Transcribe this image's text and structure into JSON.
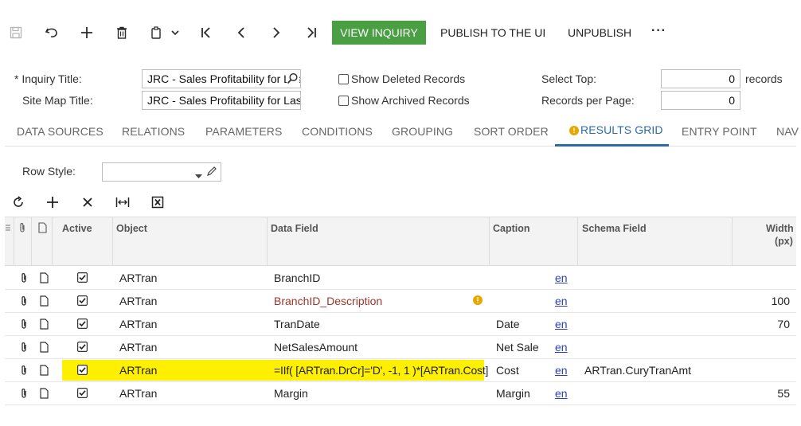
{
  "toolbar": {
    "view_inquiry": "VIEW INQUIRY",
    "publish": "PUBLISH TO THE UI",
    "unpublish": "UNPUBLISH",
    "more": "···"
  },
  "form": {
    "inquiry_title_label": "* Inquiry Title:",
    "inquiry_title_value": "JRC - Sales Profitability for Last",
    "site_map_title_label": "Site Map Title:",
    "site_map_title_value": "JRC - Sales Profitability for Last",
    "show_deleted": "Show Deleted Records",
    "show_archived": "Show Archived Records",
    "select_top_label": "Select Top:",
    "select_top_value": "0",
    "select_top_suffix": "records",
    "records_per_page_label": "Records per Page:",
    "records_per_page_value": "0"
  },
  "tabs": [
    {
      "label": "DATA SOURCES"
    },
    {
      "label": "RELATIONS"
    },
    {
      "label": "PARAMETERS"
    },
    {
      "label": "CONDITIONS"
    },
    {
      "label": "GROUPING"
    },
    {
      "label": "SORT ORDER"
    },
    {
      "label": "RESULTS GRID",
      "active": true
    },
    {
      "label": "ENTRY POINT"
    },
    {
      "label": "NAV"
    }
  ],
  "row_style": {
    "label": "Row Style:",
    "value": ""
  },
  "grid": {
    "headers": {
      "active": "Active",
      "object": "Object",
      "data_field": "Data Field",
      "caption": "Caption",
      "schema_field": "Schema Field",
      "width_line1": "Width",
      "width_line2": "(px)"
    },
    "rows": [
      {
        "object": "ARTran",
        "data_field": "BranchID",
        "caption": "",
        "lang": "en",
        "schema_field": "",
        "width": ""
      },
      {
        "object": "ARTran",
        "data_field": "BranchID_Description",
        "caption": "",
        "lang": "en",
        "schema_field": "",
        "width": "100"
      },
      {
        "object": "ARTran",
        "data_field": "TranDate",
        "caption": "Date",
        "lang": "en",
        "schema_field": "",
        "width": "70"
      },
      {
        "object": "ARTran",
        "data_field": "NetSalesAmount",
        "caption": "Net Sale",
        "lang": "en",
        "schema_field": "",
        "width": ""
      },
      {
        "object": "ARTran",
        "data_field": "=IIf( [ARTran.DrCr]='D', -1, 1 )*[ARTran.Cost]",
        "caption": "Cost",
        "lang": "en",
        "schema_field": "ARTran.CuryTranAmt",
        "width": ""
      },
      {
        "object": "ARTran",
        "data_field": "Margin",
        "caption": "Margin",
        "lang": "en",
        "schema_field": "",
        "width": "55"
      }
    ]
  },
  "colors": {
    "accent_green": "#4a9f43",
    "tab_active": "#2b6ba8",
    "highlight": "#ffef00",
    "error_text": "#a0342b",
    "warning": "#e6a700"
  }
}
